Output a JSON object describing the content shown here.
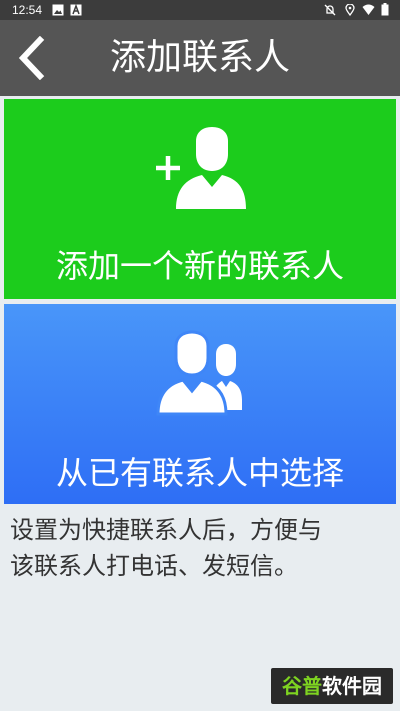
{
  "status_bar": {
    "time": "12:54",
    "left_icons": [
      "image-icon",
      "a-text-icon"
    ],
    "right_icons": [
      "no-notification-icon",
      "location-icon",
      "wifi-icon",
      "battery-icon"
    ]
  },
  "header": {
    "back_icon": "chevron-left-icon",
    "title": "添加联系人"
  },
  "actions": {
    "add_new": {
      "label": "添加一个新的联系人",
      "icon": "add-person-icon",
      "color": "#1ccc1c"
    },
    "choose_existing": {
      "label": "从已有联系人中选择",
      "icon": "people-group-icon",
      "color": "#3b82f6"
    }
  },
  "hint": {
    "line1": "设置为快捷联系人后，方便与",
    "line2": "该联系人打电话、发短信。"
  },
  "watermark": {
    "accent": "谷普",
    "rest": "软件园"
  },
  "colors": {
    "header_bg": "#555555",
    "background": "#e8edf0"
  }
}
